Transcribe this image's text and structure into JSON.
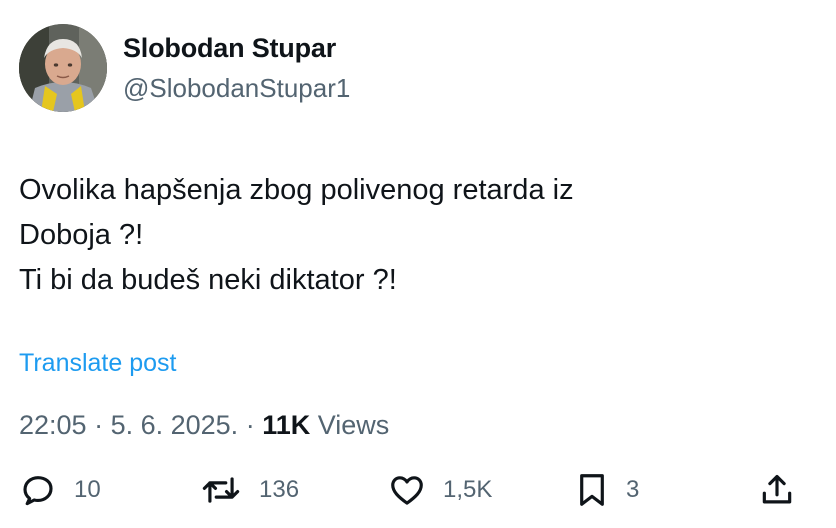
{
  "author": {
    "name": "Slobodan Stupar",
    "handle": "@SlobodanStupar1"
  },
  "tweet": {
    "lines": [
      "Ovolika hapšenja zbog polivenog retarda iz",
      "Doboja ?!",
      "Ti bi da budeš neki diktator ?!"
    ]
  },
  "translate_label": "Translate post",
  "meta": {
    "time": "22:05",
    "sep1": " · ",
    "date": "5. 6. 2025.",
    "sep2": " · ",
    "views_count": "11K",
    "views_label": " Views"
  },
  "actions": {
    "replies": "10",
    "reposts": "136",
    "likes": "1,5K",
    "bookmarks": "3"
  },
  "icons": {
    "reply": "reply-icon",
    "repost": "repost-icon",
    "like": "heart-icon",
    "bookmark": "bookmark-icon",
    "share": "share-icon"
  },
  "colors": {
    "text": "#0f1419",
    "secondary": "#536471",
    "link": "#1d9bf0"
  }
}
